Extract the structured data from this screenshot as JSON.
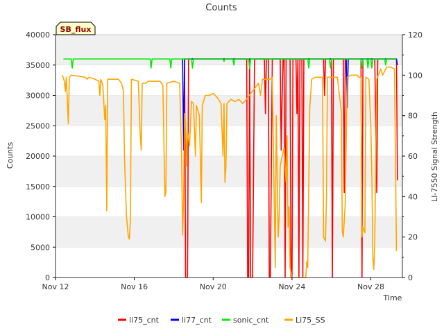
{
  "chart_data": {
    "type": "line",
    "title": "Counts",
    "xlabel": "Time",
    "ylabel": "Counts",
    "y2label": "LI-7550 Signal Strength",
    "site_label": "SB_flux",
    "x_ticks": [
      "Nov 12",
      "Nov 16",
      "Nov 20",
      "Nov 24",
      "Nov 28"
    ],
    "x_tick_days": [
      0,
      4,
      8,
      12,
      16
    ],
    "xlim_days": [
      0,
      17.6
    ],
    "ylim": [
      0,
      40000
    ],
    "y_ticks": [
      "0",
      "5000",
      "10000",
      "15000",
      "20000",
      "25000",
      "30000",
      "35000",
      "40000"
    ],
    "y_tick_values": [
      0,
      5000,
      10000,
      15000,
      20000,
      25000,
      30000,
      35000,
      40000
    ],
    "y2lim": [
      0,
      120
    ],
    "y2_ticks": [
      "0",
      "20",
      "40",
      "60",
      "80",
      "100",
      "120"
    ],
    "y2_tick_values": [
      0,
      20,
      40,
      60,
      80,
      100,
      120
    ],
    "grid_bands": true,
    "legend_position": "bottom",
    "series": [
      {
        "name": "li75_cnt",
        "color": "#ff0000",
        "axis": "left",
        "points": [
          [
            6.5,
            36000
          ],
          [
            6.55,
            36000
          ],
          [
            6.6,
            0
          ],
          [
            6.7,
            0
          ],
          [
            6.75,
            36000
          ],
          [
            9.7,
            36000
          ],
          [
            9.75,
            0
          ],
          [
            9.8,
            0
          ],
          [
            9.85,
            36000
          ],
          [
            9.9,
            0
          ],
          [
            10.0,
            0
          ],
          [
            10.1,
            36000
          ],
          [
            10.6,
            36000
          ],
          [
            10.65,
            27000
          ],
          [
            10.7,
            36000
          ],
          [
            10.8,
            36000
          ],
          [
            10.85,
            0
          ],
          [
            10.9,
            0
          ],
          [
            11.0,
            36000
          ],
          [
            11.4,
            36000
          ],
          [
            11.45,
            21000
          ],
          [
            11.5,
            30000
          ],
          [
            11.55,
            36000
          ],
          [
            11.6,
            36000
          ],
          [
            11.65,
            0
          ],
          [
            11.7,
            36000
          ],
          [
            11.9,
            36000
          ],
          [
            11.95,
            0
          ],
          [
            12.0,
            0
          ],
          [
            12.05,
            36000
          ],
          [
            12.2,
            36000
          ],
          [
            12.25,
            27000
          ],
          [
            12.3,
            36000
          ],
          [
            12.35,
            0
          ],
          [
            12.4,
            36000
          ],
          [
            12.5,
            36000
          ],
          [
            12.55,
            0
          ],
          [
            12.6,
            36000
          ],
          [
            13.6,
            36000
          ],
          [
            13.65,
            30000
          ],
          [
            13.7,
            36000
          ],
          [
            14.0,
            36000
          ],
          [
            14.05,
            0
          ],
          [
            14.1,
            36000
          ],
          [
            14.6,
            36000
          ],
          [
            14.65,
            14000
          ],
          [
            14.7,
            36000
          ],
          [
            15.5,
            36000
          ],
          [
            15.55,
            0
          ],
          [
            15.6,
            36000
          ],
          [
            16.2,
            36000
          ],
          [
            16.3,
            14000
          ],
          [
            16.35,
            36000
          ],
          [
            17.3,
            36000
          ],
          [
            17.35,
            16000
          ]
        ]
      },
      {
        "name": "li77_cnt",
        "color": "#0000ff",
        "axis": "left",
        "points": [
          [
            6.45,
            36000
          ],
          [
            6.5,
            21000
          ],
          [
            6.55,
            36000
          ],
          [
            14.75,
            36000
          ],
          [
            14.8,
            28000
          ],
          [
            14.85,
            36000
          ],
          [
            17.3,
            36000
          ],
          [
            17.35,
            35000
          ]
        ]
      },
      {
        "name": "sonic_cnt",
        "color": "#00ee00",
        "axis": "left",
        "points": [
          [
            0.4,
            36000
          ],
          [
            0.8,
            36000
          ],
          [
            0.85,
            34500
          ],
          [
            0.9,
            36000
          ],
          [
            4.8,
            36000
          ],
          [
            4.85,
            34500
          ],
          [
            4.9,
            36000
          ],
          [
            5.8,
            36000
          ],
          [
            5.85,
            34500
          ],
          [
            5.9,
            36000
          ],
          [
            6.9,
            36000
          ],
          [
            6.95,
            34500
          ],
          [
            7.0,
            36000
          ],
          [
            8.5,
            36000
          ],
          [
            8.55,
            35600
          ],
          [
            8.6,
            36000
          ],
          [
            9.0,
            36000
          ],
          [
            9.05,
            35000
          ],
          [
            9.1,
            36000
          ],
          [
            9.8,
            36000
          ],
          [
            9.85,
            34500
          ],
          [
            9.9,
            36000
          ],
          [
            12.8,
            36000
          ],
          [
            12.85,
            34500
          ],
          [
            12.9,
            36000
          ],
          [
            13.9,
            36000
          ],
          [
            13.95,
            34500
          ],
          [
            14.0,
            36000
          ],
          [
            15.5,
            36000
          ],
          [
            15.55,
            34500
          ],
          [
            15.6,
            36000
          ],
          [
            15.8,
            36000
          ],
          [
            15.85,
            34500
          ],
          [
            15.9,
            36000
          ],
          [
            16.0,
            36000
          ],
          [
            16.05,
            34500
          ],
          [
            16.1,
            36000
          ],
          [
            16.7,
            36000
          ],
          [
            16.75,
            35000
          ],
          [
            16.8,
            36000
          ],
          [
            17.3,
            36000
          ]
        ]
      },
      {
        "name": "Li75_SS",
        "color": "#ffa500",
        "axis": "right",
        "points": [
          [
            0.35,
            100
          ],
          [
            0.45,
            97
          ],
          [
            0.5,
            92
          ],
          [
            0.55,
            99
          ],
          [
            0.6,
            88
          ],
          [
            0.65,
            76
          ],
          [
            0.7,
            99
          ],
          [
            0.8,
            100
          ],
          [
            1.5,
            99
          ],
          [
            1.6,
            98
          ],
          [
            1.7,
            99
          ],
          [
            2.0,
            98
          ],
          [
            2.2,
            97
          ],
          [
            2.25,
            90
          ],
          [
            2.3,
            98
          ],
          [
            2.4,
            95
          ],
          [
            2.5,
            78
          ],
          [
            2.55,
            85
          ],
          [
            2.6,
            33
          ],
          [
            2.65,
            98
          ],
          [
            3.2,
            98
          ],
          [
            3.35,
            96
          ],
          [
            3.45,
            92
          ],
          [
            3.5,
            60
          ],
          [
            3.6,
            30
          ],
          [
            3.7,
            20
          ],
          [
            3.75,
            19
          ],
          [
            3.8,
            28
          ],
          [
            3.85,
            98
          ],
          [
            4.2,
            97
          ],
          [
            4.3,
            70
          ],
          [
            4.35,
            63
          ],
          [
            4.4,
            96
          ],
          [
            4.6,
            96
          ],
          [
            4.7,
            97
          ],
          [
            5.3,
            97
          ],
          [
            5.45,
            95
          ],
          [
            5.55,
            40
          ],
          [
            5.6,
            42
          ],
          [
            5.65,
            96
          ],
          [
            6.0,
            97
          ],
          [
            6.3,
            96
          ],
          [
            6.4,
            60
          ],
          [
            6.45,
            21
          ],
          [
            6.5,
            40
          ],
          [
            6.55,
            81
          ],
          [
            6.6,
            77
          ],
          [
            6.65,
            55
          ],
          [
            6.7,
            72
          ],
          [
            6.8,
            65
          ],
          [
            6.9,
            87
          ],
          [
            7.0,
            86
          ],
          [
            7.1,
            60
          ],
          [
            7.15,
            85
          ],
          [
            7.3,
            80
          ],
          [
            7.4,
            37
          ],
          [
            7.45,
            85
          ],
          [
            7.6,
            90
          ],
          [
            7.8,
            90
          ],
          [
            8.0,
            91
          ],
          [
            8.2,
            89
          ],
          [
            8.4,
            86
          ],
          [
            8.5,
            60
          ],
          [
            8.55,
            86
          ],
          [
            8.6,
            47
          ],
          [
            8.65,
            55
          ],
          [
            8.7,
            86
          ],
          [
            8.9,
            88
          ],
          [
            9.1,
            87
          ],
          [
            9.3,
            88
          ],
          [
            9.5,
            86
          ],
          [
            9.6,
            87
          ],
          [
            10.3,
            96
          ],
          [
            10.4,
            90
          ],
          [
            10.5,
            98
          ],
          [
            10.7,
            98
          ],
          [
            10.9,
            98
          ],
          [
            11.0,
            99
          ],
          [
            11.15,
            5
          ],
          [
            11.2,
            80
          ],
          [
            11.3,
            20
          ],
          [
            11.35,
            30
          ],
          [
            11.4,
            55
          ],
          [
            11.5,
            60
          ],
          [
            11.6,
            64
          ],
          [
            11.7,
            47
          ],
          [
            11.75,
            70
          ],
          [
            11.8,
            25
          ],
          [
            11.85,
            35
          ],
          [
            11.9,
            5
          ],
          [
            12.0,
            0
          ],
          [
            12.7,
            0
          ],
          [
            12.75,
            8
          ],
          [
            12.8,
            5
          ],
          [
            12.9,
            84
          ],
          [
            13.0,
            98
          ],
          [
            13.2,
            99
          ],
          [
            13.4,
            99
          ],
          [
            13.55,
            99
          ],
          [
            13.6,
            20
          ],
          [
            13.7,
            18
          ],
          [
            13.75,
            40
          ],
          [
            13.8,
            99
          ],
          [
            14.0,
            99
          ],
          [
            14.3,
            99
          ],
          [
            14.5,
            82
          ],
          [
            14.55,
            23
          ],
          [
            14.6,
            20
          ],
          [
            14.7,
            36
          ],
          [
            14.8,
            99
          ],
          [
            15.0,
            100
          ],
          [
            15.3,
            100
          ],
          [
            15.4,
            99
          ],
          [
            15.5,
            99
          ],
          [
            15.55,
            20
          ],
          [
            15.6,
            25
          ],
          [
            15.7,
            22
          ],
          [
            15.75,
            99
          ],
          [
            15.9,
            98
          ],
          [
            16.0,
            75
          ],
          [
            16.05,
            50
          ],
          [
            16.1,
            10
          ],
          [
            16.15,
            4
          ],
          [
            16.2,
            18
          ],
          [
            16.3,
            98
          ],
          [
            16.5,
            103
          ],
          [
            16.6,
            100
          ],
          [
            16.8,
            104
          ],
          [
            17.0,
            104
          ],
          [
            17.2,
            103
          ],
          [
            17.3,
            13
          ]
        ]
      }
    ]
  }
}
